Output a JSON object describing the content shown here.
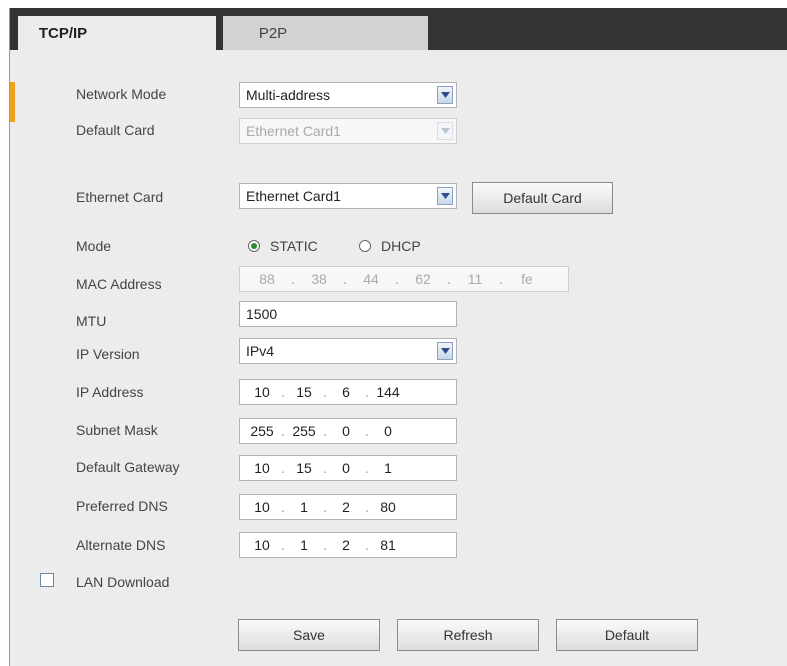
{
  "tabs": [
    {
      "label": "TCP/IP",
      "active": true
    },
    {
      "label": "P2P",
      "active": false
    }
  ],
  "form": {
    "network_mode": {
      "label": "Network Mode",
      "value": "Multi-address"
    },
    "default_card": {
      "label": "Default Card",
      "value": "Ethernet Card1"
    },
    "ethernet_card": {
      "label": "Ethernet Card",
      "value": "Ethernet Card1",
      "button": "Default Card"
    },
    "mode": {
      "label": "Mode",
      "options": [
        "STATIC",
        "DHCP"
      ],
      "selected": "STATIC"
    },
    "mac": {
      "label": "MAC Address",
      "octets": [
        "88",
        "38",
        "44",
        "62",
        "11",
        "fe"
      ]
    },
    "mtu": {
      "label": "MTU",
      "value": "1500"
    },
    "ip_version": {
      "label": "IP Version",
      "value": "IPv4"
    },
    "ip_address": {
      "label": "IP Address",
      "octets": [
        "10",
        "15",
        "6",
        "144"
      ]
    },
    "subnet_mask": {
      "label": "Subnet Mask",
      "octets": [
        "255",
        "255",
        "0",
        "0"
      ]
    },
    "default_gateway": {
      "label": "Default Gateway",
      "octets": [
        "10",
        "15",
        "0",
        "1"
      ]
    },
    "preferred_dns": {
      "label": "Preferred DNS",
      "octets": [
        "10",
        "1",
        "2",
        "80"
      ]
    },
    "alternate_dns": {
      "label": "Alternate DNS",
      "octets": [
        "10",
        "1",
        "2",
        "81"
      ]
    },
    "lan_download": {
      "label": "LAN Download",
      "checked": false
    }
  },
  "buttons": {
    "save": "Save",
    "refresh": "Refresh",
    "default": "Default"
  },
  "colors": {
    "tabbar": "#333333",
    "panel": "#ececec",
    "accent": "#f0a020",
    "radio_selected": "#2a8a2a"
  }
}
